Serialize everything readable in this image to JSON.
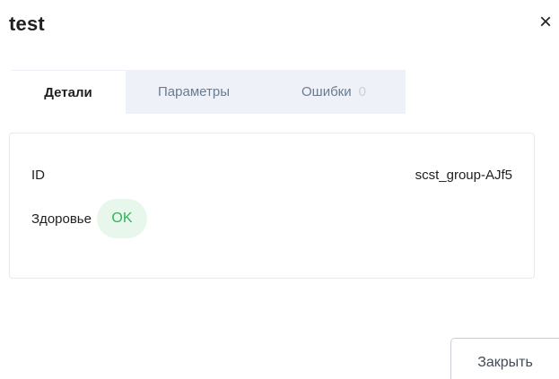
{
  "dialog": {
    "title": "test",
    "close_icon": "×"
  },
  "tabs": [
    {
      "label": "Детали",
      "active": true
    },
    {
      "label": "Параметры",
      "active": false
    },
    {
      "label": "Ошибки",
      "count": "0",
      "active": false
    }
  ],
  "details": {
    "id_label": "ID",
    "id_value": "scst_group-AJf5",
    "health_label": "Здоровье",
    "health_value": "OK"
  },
  "footer": {
    "close_button": "Закрыть"
  },
  "colors": {
    "accent_ok_text": "#34b35a",
    "accent_ok_bg": "#e8f7ec",
    "tab_bar_bg": "#eef2f8"
  }
}
